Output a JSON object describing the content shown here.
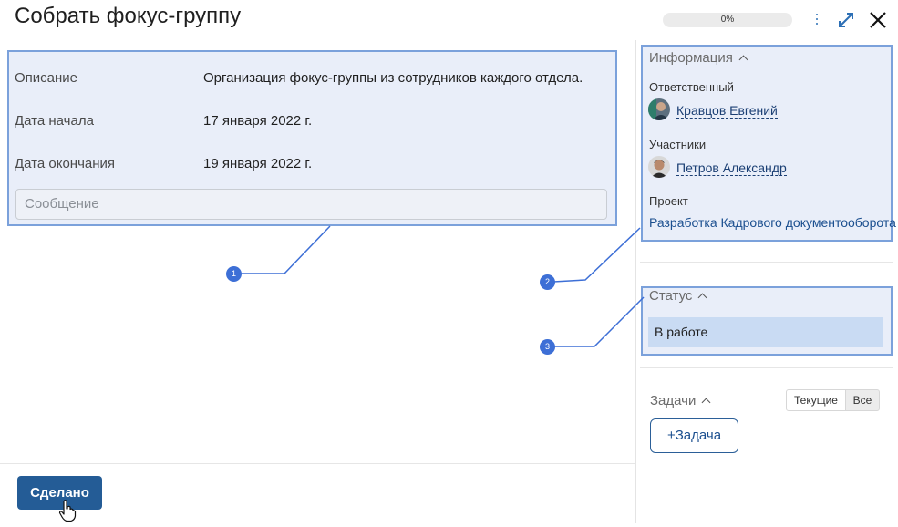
{
  "header": {
    "title": "Собрать фокус-группу",
    "progress_text": "0%",
    "progress_value": 0
  },
  "details": {
    "description_label": "Описание",
    "description_value": "Организация фокус-группы из сотрудников каждого отдела.",
    "start_label": "Дата начала",
    "start_value": "17 января 2022 г.",
    "end_label": "Дата окончания",
    "end_value": "19 января 2022 г.",
    "message_placeholder": "Сообщение"
  },
  "info": {
    "title": "Информация",
    "responsible_label": "Ответственный",
    "responsible_name": "Кравцов Евгений",
    "participants_label": "Участники",
    "participant_name": "Петров Александр",
    "project_label": "Проект",
    "project_name": "Разработка Кадрового документооборота"
  },
  "status": {
    "title": "Статус",
    "value": "В работе"
  },
  "tasks": {
    "title": "Задачи",
    "filter_current": "Текущие",
    "filter_all": "Все",
    "add_label": "+Задача"
  },
  "footer": {
    "done_label": "Сделано"
  },
  "callouts": [
    "1",
    "2",
    "3"
  ],
  "colors": {
    "highlight_fill": "#e9eef9",
    "highlight_border": "#7ba1db",
    "callout": "#3d6fd6",
    "primary_button": "#245c96",
    "status_fill": "#c9dbf3"
  }
}
